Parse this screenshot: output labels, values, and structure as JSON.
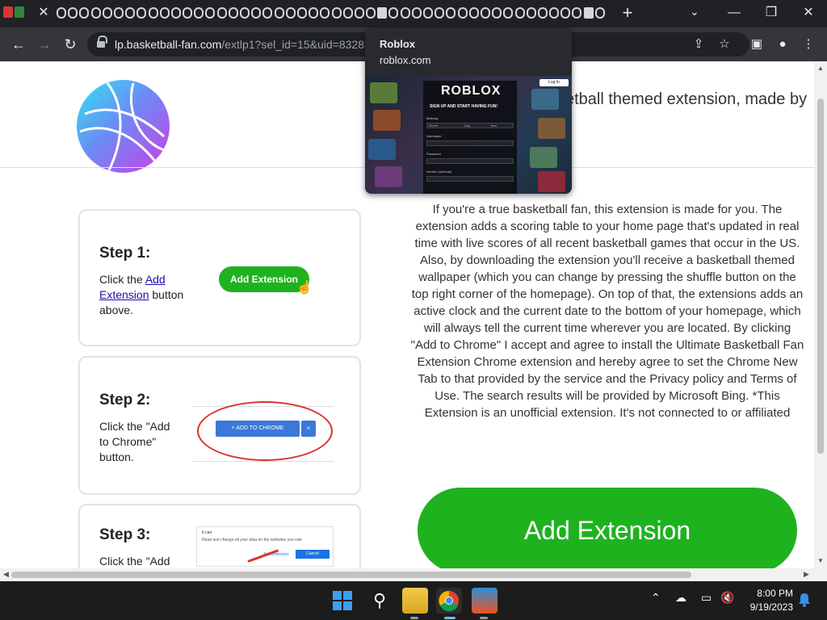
{
  "browser": {
    "url_host": "lp.basketball-fan.com",
    "url_path": "/extlp1?sel_id=15&uid=8328",
    "window_controls": {
      "minimize": "—",
      "restore": "❐",
      "close": "✕"
    },
    "new_tab": "+",
    "tab_search": "⌄"
  },
  "hovercard": {
    "title": "Roblox",
    "domain": "roblox.com",
    "thumb": {
      "logo": "ROBLOX",
      "tagline": "SIGN UP AND START HAVING FUN!",
      "login": "Log In",
      "birthday_label": "Birthday",
      "month": "Month",
      "day": "Day",
      "year": "Year",
      "username_label": "Username",
      "password_label": "Password",
      "gender_label": "Gender (optional)"
    }
  },
  "page": {
    "tagline": "ketball themed extension, made by",
    "steps": [
      {
        "title": "Step 1:",
        "text_before": "Click the ",
        "link": "Add Extension",
        "text_after": " button above.",
        "button": "Add Extension"
      },
      {
        "title": "Step 2:",
        "text": "Click the \"Add to Chrome\" button.",
        "button": "ADD TO CHROME"
      },
      {
        "title": "Step 3:",
        "text": "Click the \"Add",
        "mock_title": "It can:",
        "mock_text": "Read and change all your data on the websites you visit",
        "mock_add": "Add extension",
        "mock_cancel": "Cancel"
      }
    ],
    "description": "If you're a true basketball fan, this extension is made for you. The extension adds a scoring table to your home page that's updated in real time with live scores of all recent basketball games that occur in the US. Also, by downloading the extension you'll receive a basketball themed wallpaper (which you can change by pressing the shuffle button on the top right corner of the homepage). On top of that, the extensions adds an active clock and the current date to the bottom of your homepage, which will always tell the current time wherever you are located. By clicking \"Add to Chrome\" I accept and agree to install the Ultimate Basketball Fan Extension Chrome extension and hereby agree to set the Chrome New Tab to that provided by the service and the Privacy policy and Terms of Use. The search results will be provided by Microsoft Bing. *This Extension is an unofficial extension. It's not connected to or affiliated",
    "cta": "Add Extension"
  },
  "taskbar": {
    "time": "8:00 PM",
    "date": "9/19/2023"
  },
  "colors": {
    "tabstrip": "#202124",
    "toolbar": "#35363a",
    "cta_green": "#1fb21f",
    "chrome_blue": "#3c78d8",
    "ellipse_red": "#d9322b"
  }
}
